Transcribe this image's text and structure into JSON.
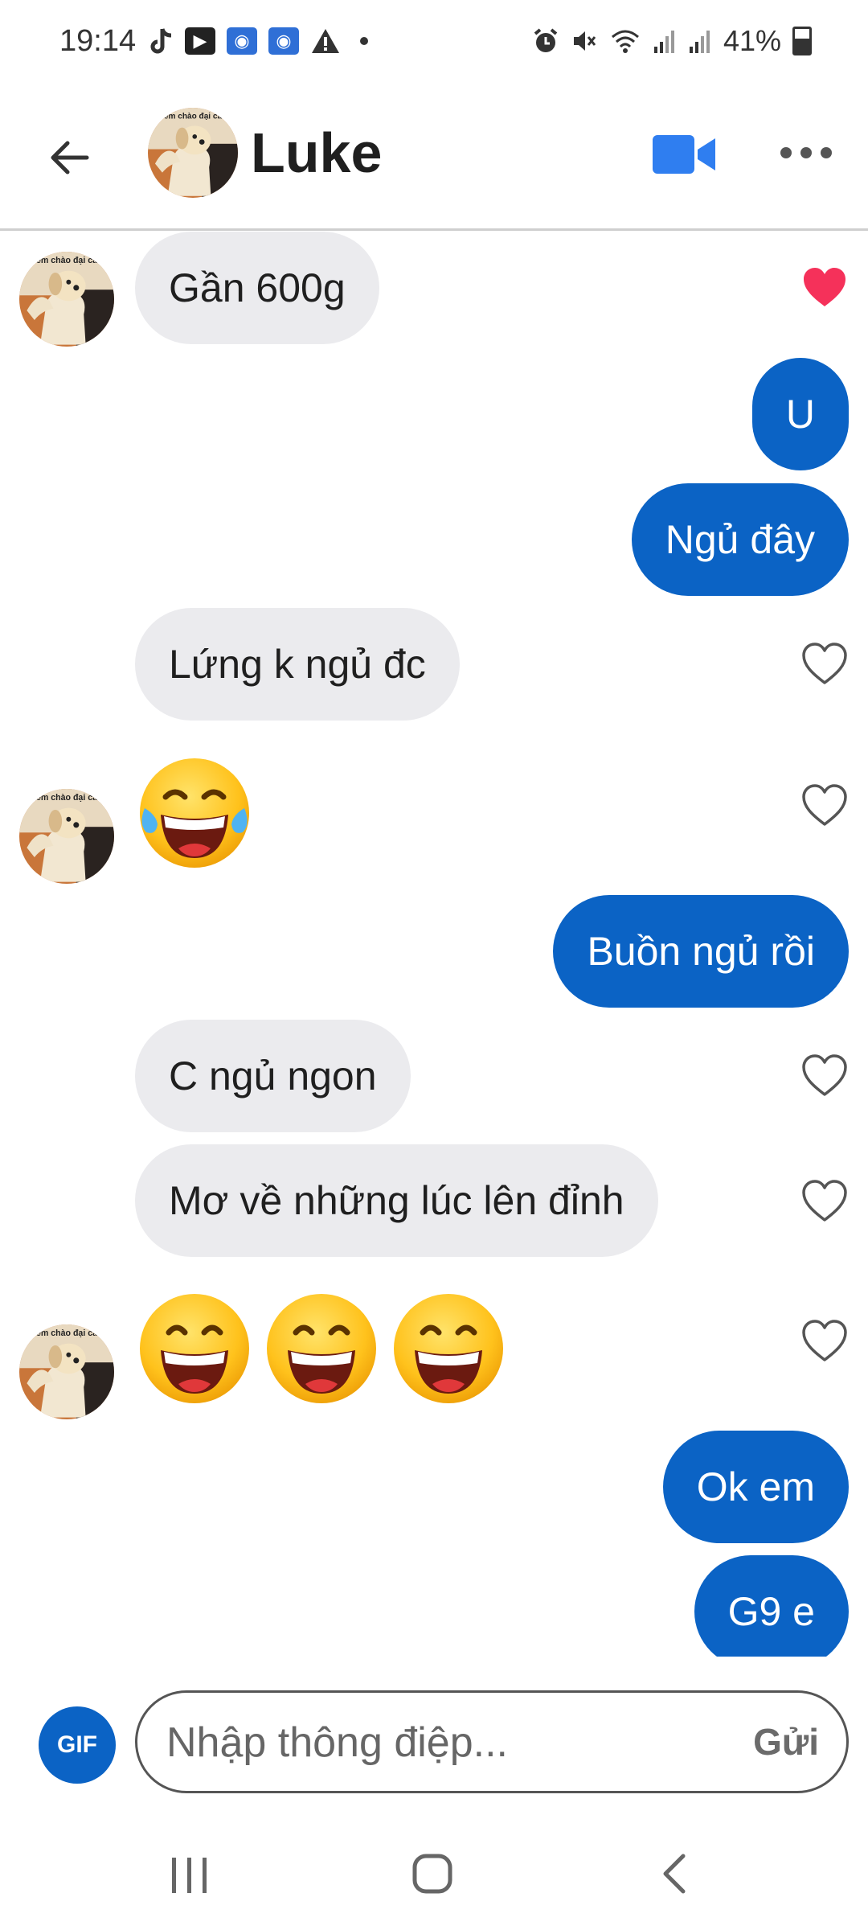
{
  "status_bar": {
    "time": "19:14",
    "battery": "41%",
    "left_icons": [
      "tiktok-icon",
      "youtube-icon",
      "app-icon",
      "app-icon",
      "warning-icon",
      "dot-icon"
    ],
    "right_icons": [
      "alarm-icon",
      "mute-icon",
      "wifi-icon",
      "signal-icon",
      "signal-icon",
      "battery-icon"
    ]
  },
  "header": {
    "contact_name": "Luke",
    "avatar_caption": "em chào đại ca"
  },
  "messages": [
    {
      "side": "in",
      "text": "Gần 600g",
      "liked": true
    },
    {
      "side": "out",
      "text": "U"
    },
    {
      "side": "out",
      "text": "Ngủ đây"
    },
    {
      "side": "in",
      "text": "Lứng k ngủ đc",
      "liked": false
    },
    {
      "side": "in",
      "emoji": [
        "tears-of-joy"
      ],
      "liked": false
    },
    {
      "side": "out",
      "text": "Buồn ngủ rồi"
    },
    {
      "side": "in",
      "text": "C ngủ ngon",
      "liked": false
    },
    {
      "side": "in",
      "text": "Mơ về những lúc lên đỉnh",
      "liked": false
    },
    {
      "side": "in",
      "emoji": [
        "grinning",
        "grinning",
        "grinning"
      ],
      "liked": false
    },
    {
      "side": "out",
      "text": "Ok em"
    },
    {
      "side": "out",
      "text": "G9 e"
    }
  ],
  "composer": {
    "gif_label": "GIF",
    "placeholder": "Nhập thông điệp...",
    "send_label": "Gửi"
  },
  "colors": {
    "accent": "#0b63c5",
    "incoming_bubble": "#ebebee",
    "heart": "#f5315a"
  }
}
